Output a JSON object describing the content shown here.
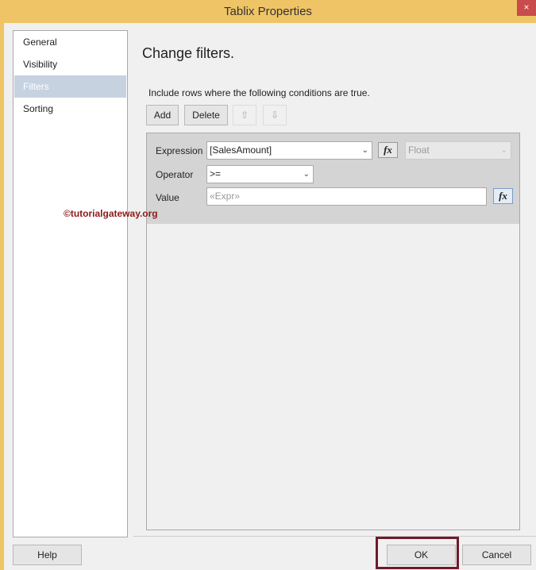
{
  "window": {
    "title": "Tablix Properties",
    "close": "×"
  },
  "sidebar": {
    "items": [
      {
        "label": "General"
      },
      {
        "label": "Visibility"
      },
      {
        "label": "Filters"
      },
      {
        "label": "Sorting"
      }
    ]
  },
  "main": {
    "heading": "Change filters.",
    "hint": "Include rows where the following conditions are true.",
    "toolbar": {
      "add": "Add",
      "delete": "Delete",
      "up": "⇧",
      "down": "⇩"
    },
    "filter": {
      "expression_label": "Expression",
      "expression_value": "[SalesAmount]",
      "type_value": "Float",
      "operator_label": "Operator",
      "operator_value": ">=",
      "value_label": "Value",
      "value_placeholder": "«Expr»",
      "fx": "fx"
    }
  },
  "watermark": "©tutorialgateway.org",
  "footer": {
    "help": "Help",
    "ok": "OK",
    "cancel": "Cancel"
  }
}
